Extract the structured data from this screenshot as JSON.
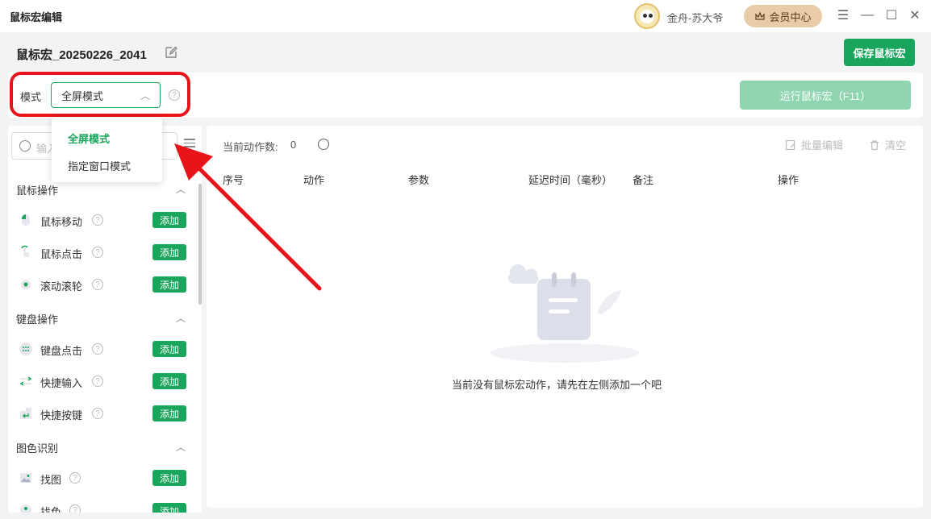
{
  "app": {
    "title": "鼠标宏编辑"
  },
  "user": {
    "name": "金舟-苏大爷",
    "vip_label": "会员中心"
  },
  "window_controls": {
    "menu": "☰",
    "minimize": "—",
    "maximize": "☐",
    "close": "✕"
  },
  "macro": {
    "name": "鼠标宏_20250226_2041",
    "save_label": "保存鼠标宏"
  },
  "mode": {
    "label": "模式",
    "selected": "全屏模式",
    "options": [
      "全屏模式",
      "指定窗口模式"
    ],
    "run_label": "运行鼠标宏（F11）"
  },
  "sidebar": {
    "search_placeholder": "输入",
    "add_label": "添加",
    "sections": [
      {
        "title": "鼠标操作",
        "items": [
          "鼠标移动",
          "鼠标点击",
          "滚动滚轮"
        ]
      },
      {
        "title": "键盘操作",
        "items": [
          "键盘点击",
          "快捷输入",
          "快捷按键"
        ]
      },
      {
        "title": "图色识别",
        "items": [
          "找图",
          "找色"
        ]
      }
    ]
  },
  "main": {
    "action_count_label": "当前动作数:",
    "action_count": "0",
    "batch_edit_label": "批量编辑",
    "clear_label": "清空",
    "columns": [
      "序号",
      "动作",
      "参数",
      "延迟时间（毫秒）",
      "备注",
      "操作"
    ],
    "empty_message": "当前没有鼠标宏动作，请先在左侧添加一个吧"
  },
  "colors": {
    "accent": "#19a65c",
    "highlight": "#e8141a",
    "vip": "#e8cca7"
  }
}
